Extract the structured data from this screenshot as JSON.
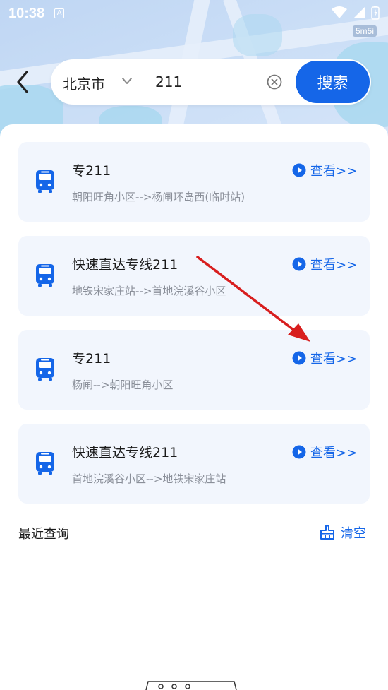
{
  "status": {
    "time": "10:38",
    "notif_icon": "A",
    "tag": "5m5i"
  },
  "search": {
    "city": "北京市",
    "query": "211",
    "button_label": "搜索"
  },
  "results": [
    {
      "title": "专211",
      "route": "朝阳旺角小区-->杨闸环岛西(临时站)",
      "view_label": "查看>>"
    },
    {
      "title": "快速直达专线211",
      "route": "地铁宋家庄站-->首地浣溪谷小区",
      "view_label": "查看>>"
    },
    {
      "title": "专211",
      "route": "杨闸-->朝阳旺角小区",
      "view_label": "查看>>"
    },
    {
      "title": "快速直达专线211",
      "route": "首地浣溪谷小区-->地铁宋家庄站",
      "view_label": "查看>>"
    }
  ],
  "recent": {
    "label": "最近查询",
    "clear_label": "清空"
  },
  "colors": {
    "accent": "#1566e8",
    "card_bg": "#f2f6fd",
    "annotation_arrow": "#d81e1e"
  }
}
